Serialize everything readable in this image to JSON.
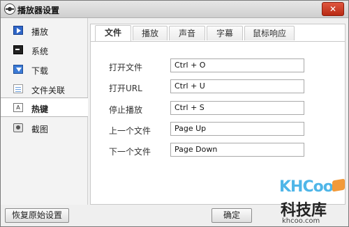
{
  "window": {
    "title": "播放器设置",
    "close_glyph": "✕"
  },
  "sidebar": {
    "items": [
      {
        "label": "播放",
        "icon": "play-icon"
      },
      {
        "label": "系统",
        "icon": "system-icon"
      },
      {
        "label": "下载",
        "icon": "download-icon"
      },
      {
        "label": "文件关联",
        "icon": "file-association-icon"
      },
      {
        "label": "热键",
        "icon": "hotkey-icon",
        "active": true
      },
      {
        "label": "截图",
        "icon": "screenshot-icon"
      }
    ]
  },
  "tabs": [
    {
      "label": "文件",
      "active": true
    },
    {
      "label": "播放"
    },
    {
      "label": "声音"
    },
    {
      "label": "字幕"
    },
    {
      "label": "鼠标响应"
    }
  ],
  "hotkeys": [
    {
      "label": "打开文件",
      "value": "Ctrl + O"
    },
    {
      "label": "打开URL",
      "value": "Ctrl + U"
    },
    {
      "label": "停止播放",
      "value": "Ctrl + S"
    },
    {
      "label": "上一个文件",
      "value": "Page Up"
    },
    {
      "label": "下一个文件",
      "value": "Page Down"
    }
  ],
  "buttons": {
    "reset": "恢复原始设置",
    "ok": "确定"
  },
  "watermark": {
    "logo": "KHCoo",
    "name": "科技库",
    "url": "khcoo.com"
  },
  "colors": {
    "close": "#c8361e",
    "active_bg": "#ffffff",
    "watermark_blue": "#4fb6e8"
  }
}
